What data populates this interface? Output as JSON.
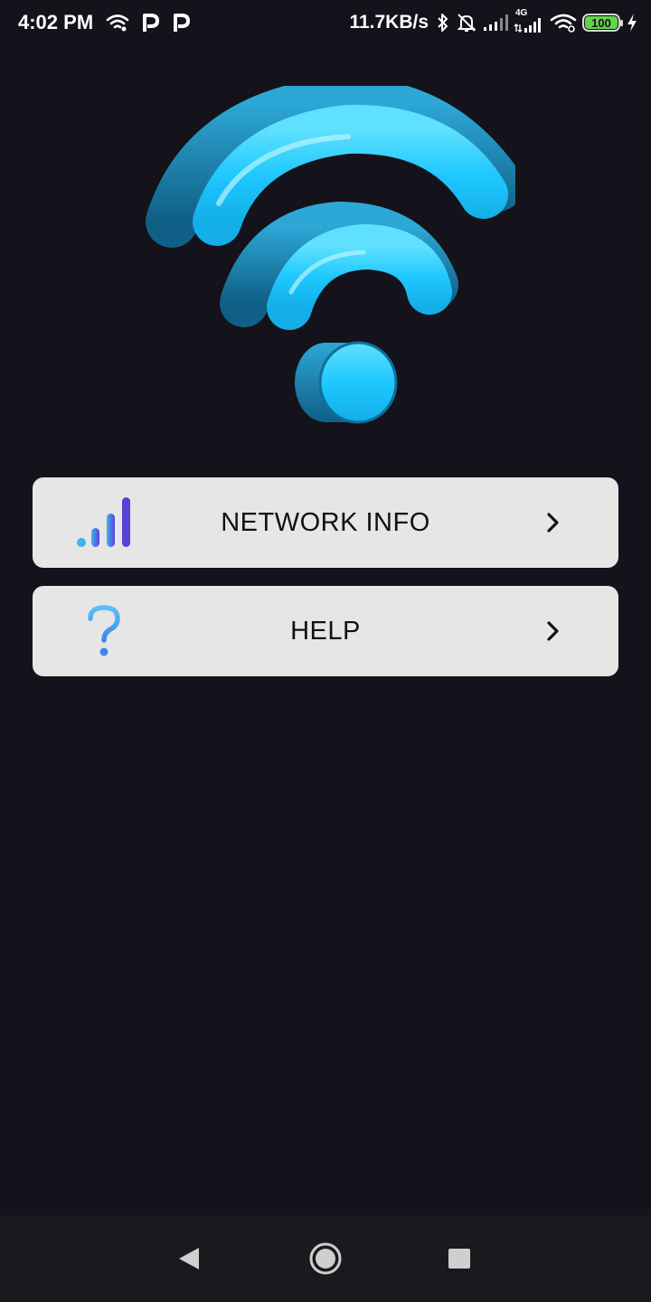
{
  "status_bar": {
    "time": "4:02 PM",
    "net_speed": "11.7KB/s",
    "network_type": "4G",
    "battery_level": "100",
    "icons": [
      "wifi-icon",
      "parking-p-icon",
      "parking-p-icon",
      "bluetooth-icon",
      "alarm-off-icon",
      "signal-icon",
      "signal-4g-icon",
      "wifi-icon",
      "battery-icon",
      "charging-icon"
    ]
  },
  "hero": {
    "icon": "wifi-3d-logo",
    "color": "#1ec8ff"
  },
  "menu": {
    "items": [
      {
        "label": "NETWORK INFO",
        "icon": "signal-bars-icon",
        "accent": "#4f5bd5"
      },
      {
        "label": "HELP",
        "icon": "question-mark-icon",
        "accent": "#4aa3f5"
      }
    ]
  },
  "nav_bar": {
    "buttons": [
      "back-icon",
      "home-icon",
      "recent-apps-icon"
    ]
  }
}
